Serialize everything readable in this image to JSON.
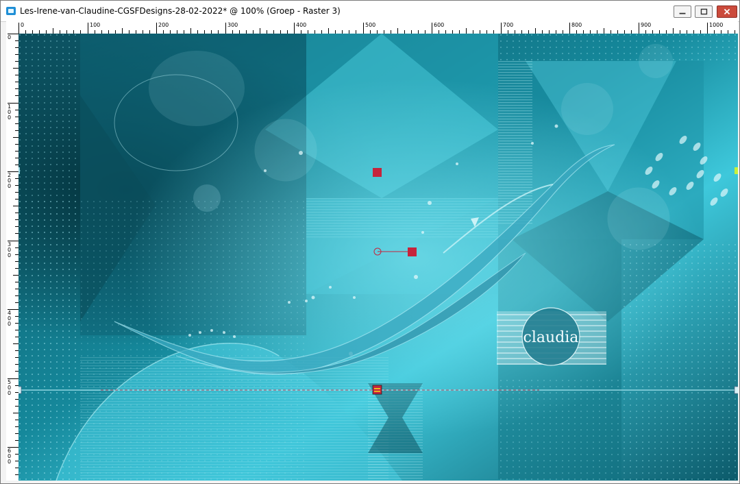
{
  "window": {
    "title": "Les-Irene-van-Claudine-CGSFDesigns-28-02-2022* @ 100% (Groep - Raster 3)"
  },
  "window_buttons": [
    "minimize-icon",
    "restore-icon",
    "close-icon"
  ],
  "ruler": {
    "horizontal_labels": [
      "0",
      "100",
      "200",
      "300",
      "400",
      "500",
      "600",
      "700",
      "800",
      "900",
      "1000"
    ],
    "vertical_labels": [
      "0",
      "100",
      "200",
      "300",
      "400",
      "500",
      "600"
    ]
  },
  "canvas": {
    "watermark_text": "claudia",
    "colors": {
      "deep": "#0a4f5e",
      "mid": "#18869a",
      "light": "#4fd2e3",
      "guide": "#a9e6f0",
      "handle_red": "#c6243c"
    }
  }
}
